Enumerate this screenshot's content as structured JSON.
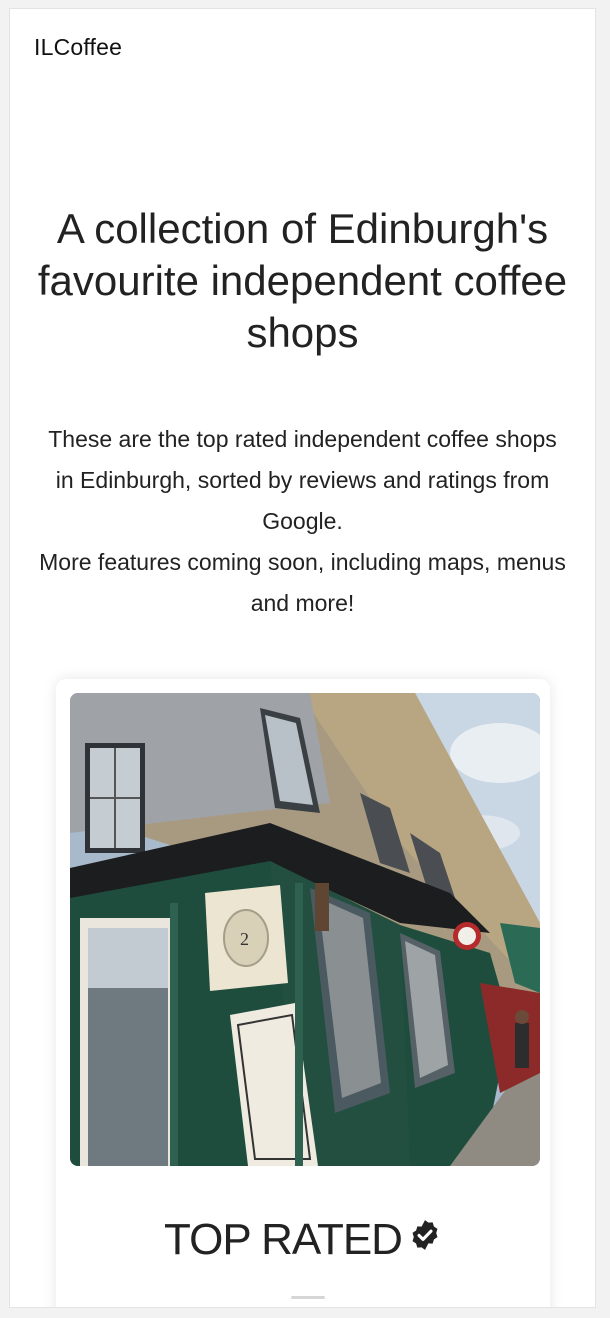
{
  "header": {
    "brand": "ILCoffee"
  },
  "hero": {
    "title": "A collection of Edinburgh's favourite independent coffee shops",
    "description_line1": "These are the top rated independent coffee shops in Edinburgh, sorted by reviews and ratings from Google.",
    "description_line2": "More features coming soon, including maps, menus and more!"
  },
  "featured_card": {
    "image_alt": "Corner coffee shop with green shopfront on a stone building",
    "heading": "TOP RATED",
    "badge_icon": "verified-badge-icon"
  },
  "colors": {
    "shopfront_green": "#1f4d3d",
    "background": "#f2f2f2"
  }
}
